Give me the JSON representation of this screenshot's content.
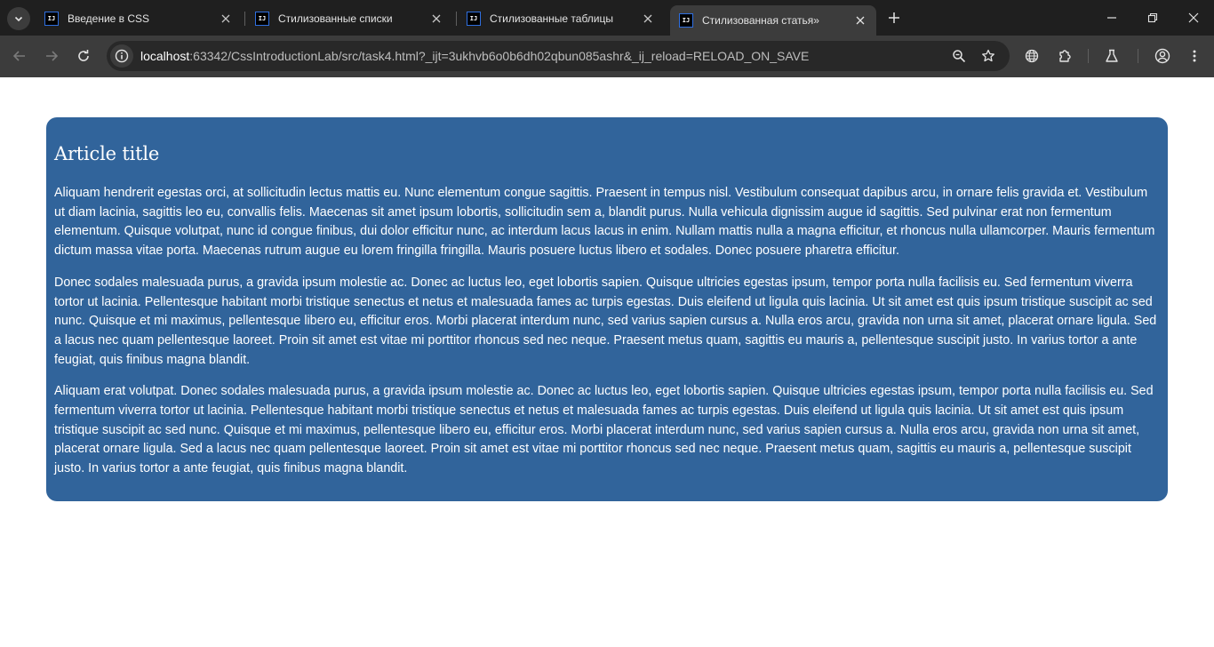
{
  "browser": {
    "tabs": [
      {
        "favicon": "IJ",
        "title": "Введение в CSS",
        "active": false
      },
      {
        "favicon": "IJ",
        "title": "Стилизованные списки",
        "active": false
      },
      {
        "favicon": "IJ",
        "title": "Стилизованные таблицы",
        "active": false
      },
      {
        "favicon": "IJ",
        "title": "Стилизованная статья»",
        "active": true
      }
    ],
    "address": {
      "host": "localhost",
      "rest": ":63342/CssIntroductionLab/src/task4.html?_ijt=3ukhvb6o0b6dh02qbun085ashr&_ij_reload=RELOAD_ON_SAVE"
    },
    "icons": [
      "tab-search-icon",
      "back-arrow-icon",
      "forward-arrow-icon",
      "reload-icon",
      "site-info-icon",
      "zoom-icon",
      "bookmark-star-icon",
      "translate-icon",
      "extensions-icon",
      "labs-flask-icon",
      "profile-icon",
      "menu-kebab-icon",
      "minimize-icon",
      "restore-icon",
      "close-icon",
      "new-tab-plus-icon"
    ]
  },
  "article": {
    "title": "Article title",
    "paragraphs": [
      "Aliquam hendrerit egestas orci, at sollicitudin lectus mattis eu. Nunc elementum congue sagittis. Praesent in tempus nisl. Vestibulum consequat dapibus arcu, in ornare felis gravida et. Vestibulum ut diam lacinia, sagittis leo eu, convallis felis. Maecenas sit amet ipsum lobortis, sollicitudin sem a, blandit purus. Nulla vehicula dignissim augue id sagittis. Sed pulvinar erat non fermentum elementum. Quisque volutpat, nunc id congue finibus, dui dolor efficitur nunc, ac interdum lacus lacus in enim. Nullam mattis nulla a magna efficitur, et rhoncus nulla ullamcorper. Mauris fermentum dictum massa vitae porta. Maecenas rutrum augue eu lorem fringilla fringilla. Mauris posuere luctus libero et sodales. Donec posuere pharetra efficitur.",
      "Donec sodales malesuada purus, a gravida ipsum molestie ac. Donec ac luctus leo, eget lobortis sapien. Quisque ultricies egestas ipsum, tempor porta nulla facilisis eu. Sed fermentum viverra tortor ut lacinia. Pellentesque habitant morbi tristique senectus et netus et malesuada fames ac turpis egestas. Duis eleifend ut ligula quis lacinia. Ut sit amet est quis ipsum tristique suscipit ac sed nunc. Quisque et mi maximus, pellentesque libero eu, efficitur eros. Morbi placerat interdum nunc, sed varius sapien cursus a. Nulla eros arcu, gravida non urna sit amet, placerat ornare ligula. Sed a lacus nec quam pellentesque laoreet. Proin sit amet est vitae mi porttitor rhoncus sed nec neque. Praesent metus quam, sagittis eu mauris a, pellentesque suscipit justo. In varius tortor a ante feugiat, quis finibus magna blandit.",
      "Aliquam erat volutpat. Donec sodales malesuada purus, a gravida ipsum molestie ac. Donec ac luctus leo, eget lobortis sapien. Quisque ultricies egestas ipsum, tempor porta nulla facilisis eu. Sed fermentum viverra tortor ut lacinia. Pellentesque habitant morbi tristique senectus et netus et malesuada fames ac turpis egestas. Duis eleifend ut ligula quis lacinia. Ut sit amet est quis ipsum tristique suscipit ac sed nunc. Quisque et mi maximus, pellentesque libero eu, efficitur eros. Morbi placerat interdum nunc, sed varius sapien cursus a. Nulla eros arcu, gravida non urna sit amet, placerat ornare ligula. Sed a lacus nec quam pellentesque laoreet. Proin sit amet est vitae mi porttitor rhoncus sed nec neque. Praesent metus quam, sagittis eu mauris a, pellentesque suscipit justo. In varius tortor a ante feugiat, quis finibus magna blandit."
    ]
  },
  "colors": {
    "tabstrip": "#1f1f1f",
    "toolbar": "#3c3c3c",
    "omnibox": "#282828",
    "article_bg": "#31649b",
    "article_text": "#ffffff"
  }
}
